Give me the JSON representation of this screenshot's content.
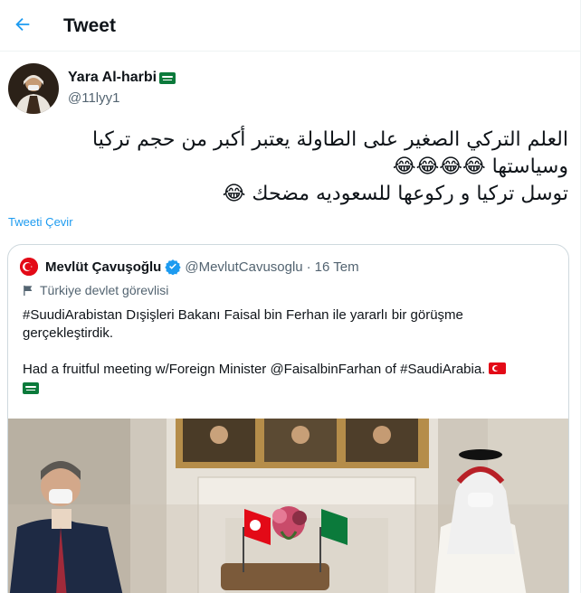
{
  "header": {
    "title": "Tweet",
    "back_icon": "arrow-left-icon"
  },
  "tweet": {
    "author_name": "Yara Al-harbi",
    "author_flag": "saudi-flag-emoji",
    "author_handle": "@11lyy1",
    "text_line_1": "العلم التركي الصغير على الطاولة يعتبر أكبر من حجم تركيا",
    "text_line_2": "وسياستها 😂😂😂😂",
    "text_line_3": "توسل تركيا و ركوعها للسعوديه مضحك 😂",
    "translate_label": "Tweeti Çevir"
  },
  "quote": {
    "author_name": "Mevlüt Çavuşoğlu",
    "verified": true,
    "author_handle": "@MevlutCavusoglu",
    "separator": "·",
    "date": "16 Tem",
    "account_label": "Türkiye devlet görevlisi",
    "text_tr": "#SuudiArabistan Dışişleri Bakanı Faisal bin Ferhan ile yararlı  bir görüşme gerçekleştirdik.",
    "text_en_prefix": "Had a fruitful meeting w/Foreign Minister ",
    "text_en_mention": "@FaisalbinFarhan",
    "text_en_middle": " of ",
    "text_en_hashtag": "#SaudiArabia.",
    "flags": [
      "turkey-flag-emoji",
      "saudi-flag-emoji"
    ]
  },
  "colors": {
    "accent": "#1d9bf0",
    "text_primary": "#0f1419",
    "text_secondary": "#536471",
    "border": "#cfd9de"
  }
}
